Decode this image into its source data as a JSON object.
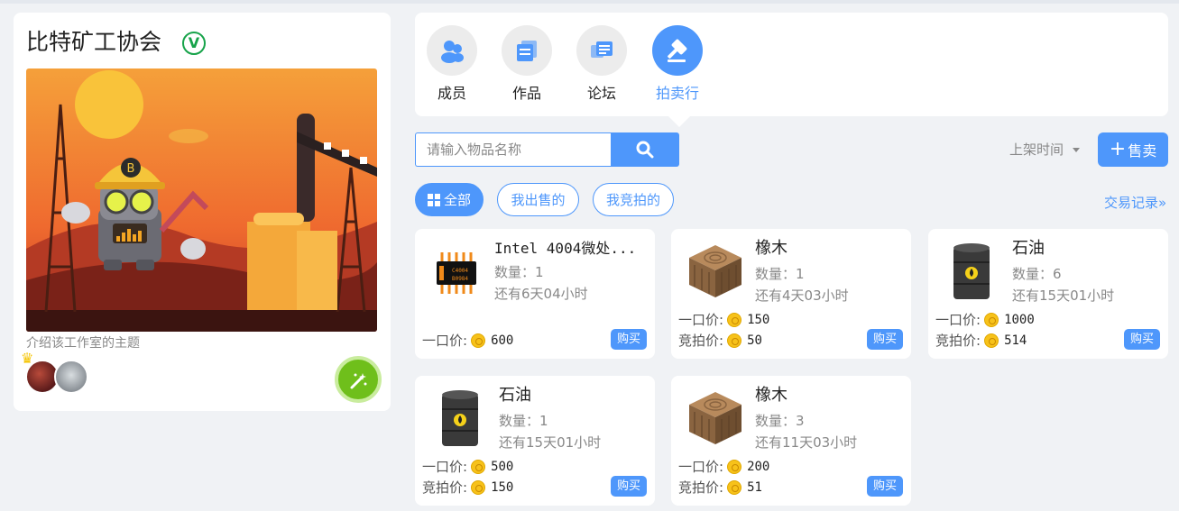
{
  "studio": {
    "title": "比特矿工协会",
    "verified_mark": "V",
    "description": "介绍该工作室的主题"
  },
  "tabs": [
    {
      "label": "成员",
      "icon": "members-icon"
    },
    {
      "label": "作品",
      "icon": "works-icon"
    },
    {
      "label": "论坛",
      "icon": "forum-icon"
    },
    {
      "label": "拍卖行",
      "icon": "auction-icon",
      "active": true
    }
  ],
  "search": {
    "placeholder": "请输入物品名称"
  },
  "sort": {
    "label": "上架时间"
  },
  "sell_button": {
    "label": "售卖"
  },
  "filters": [
    {
      "label": "全部",
      "active": true
    },
    {
      "label": "我出售的"
    },
    {
      "label": "我竞拍的"
    }
  ],
  "trade_link": "交易记录»",
  "cards": [
    {
      "name": "Intel 4004微处...",
      "qty": "数量：1",
      "time": "还有6天04小时",
      "fixed_label": "一口价:",
      "fixed_price": "600",
      "buy": "购买",
      "image": "chip"
    },
    {
      "name": "橡木",
      "qty": "数量：1",
      "time": "还有4天03小时",
      "fixed_label": "一口价:",
      "fixed_price": "150",
      "bid_label": "竞拍价:",
      "bid_price": "50",
      "buy": "购买",
      "image": "wood"
    },
    {
      "name": "石油",
      "qty": "数量：6",
      "time": "还有15天01小时",
      "fixed_label": "一口价:",
      "fixed_price": "1000",
      "bid_label": "竞拍价:",
      "bid_price": "514",
      "buy": "购买",
      "image": "oil"
    },
    {
      "name": "石油",
      "qty": "数量：1",
      "time": "还有15天01小时",
      "fixed_label": "一口价:",
      "fixed_price": "500",
      "bid_label": "竞拍价:",
      "bid_price": "150",
      "buy": "购买",
      "image": "oil"
    },
    {
      "name": "橡木",
      "qty": "数量：3",
      "time": "还有11天03小时",
      "fixed_label": "一口价:",
      "fixed_price": "200",
      "bid_label": "竞拍价:",
      "bid_price": "51",
      "buy": "购买",
      "image": "wood"
    }
  ],
  "colors": {
    "accent": "#4e97fb",
    "background": "#f0f2f5",
    "verified": "#17a34a",
    "coin": "#f7c21a",
    "magic_button": "#6fbf1b"
  }
}
